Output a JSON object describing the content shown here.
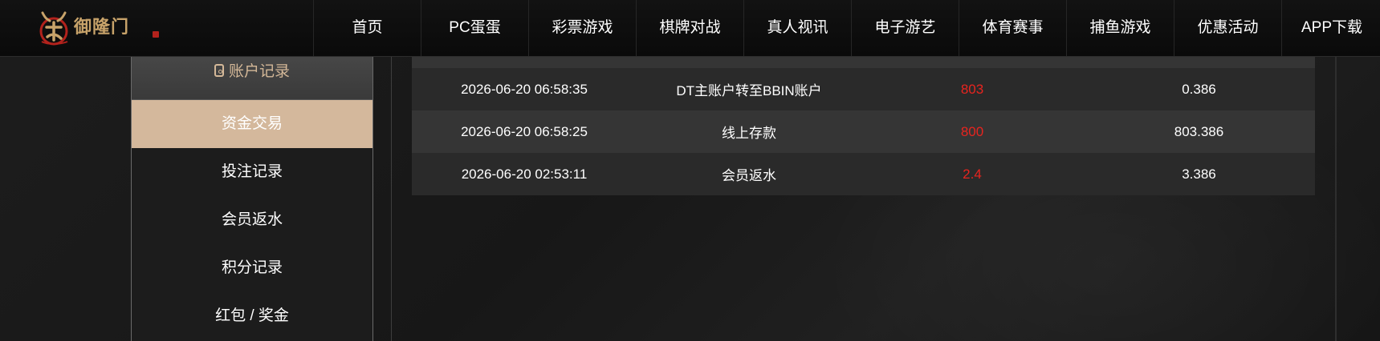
{
  "brand": {
    "name": "御隆门",
    "tagline": "",
    "accent_color": "#c8a36a"
  },
  "nav": {
    "items": [
      {
        "label": "首页"
      },
      {
        "label": "PC蛋蛋"
      },
      {
        "label": "彩票游戏"
      },
      {
        "label": "棋牌对战"
      },
      {
        "label": "真人视讯"
      },
      {
        "label": "电子游艺"
      },
      {
        "label": "体育赛事"
      },
      {
        "label": "捕鱼游戏"
      },
      {
        "label": "优惠活动"
      },
      {
        "label": "APP下载"
      }
    ]
  },
  "sidebar": {
    "header": {
      "label": "账户记录",
      "icon": "ledger-icon"
    },
    "active_color": "#d4b89c",
    "items": [
      {
        "label": "资金交易",
        "active": true
      },
      {
        "label": "投注记录",
        "active": false
      },
      {
        "label": "会员返水",
        "active": false
      },
      {
        "label": "积分记录",
        "active": false
      },
      {
        "label": "红包 / 奖金",
        "active": false
      }
    ]
  },
  "transactions": {
    "amount_color": "#e8241f",
    "rows": [
      {
        "time": "2026-06-20 06:58:35",
        "type": "DT主账户转至BBIN账户",
        "amount": "803",
        "balance": "0.386"
      },
      {
        "time": "2026-06-20 06:58:25",
        "type": "线上存款",
        "amount": "800",
        "balance": "803.386"
      },
      {
        "time": "2026-06-20 02:53:11",
        "type": "会员返水",
        "amount": "2.4",
        "balance": "3.386"
      }
    ]
  }
}
